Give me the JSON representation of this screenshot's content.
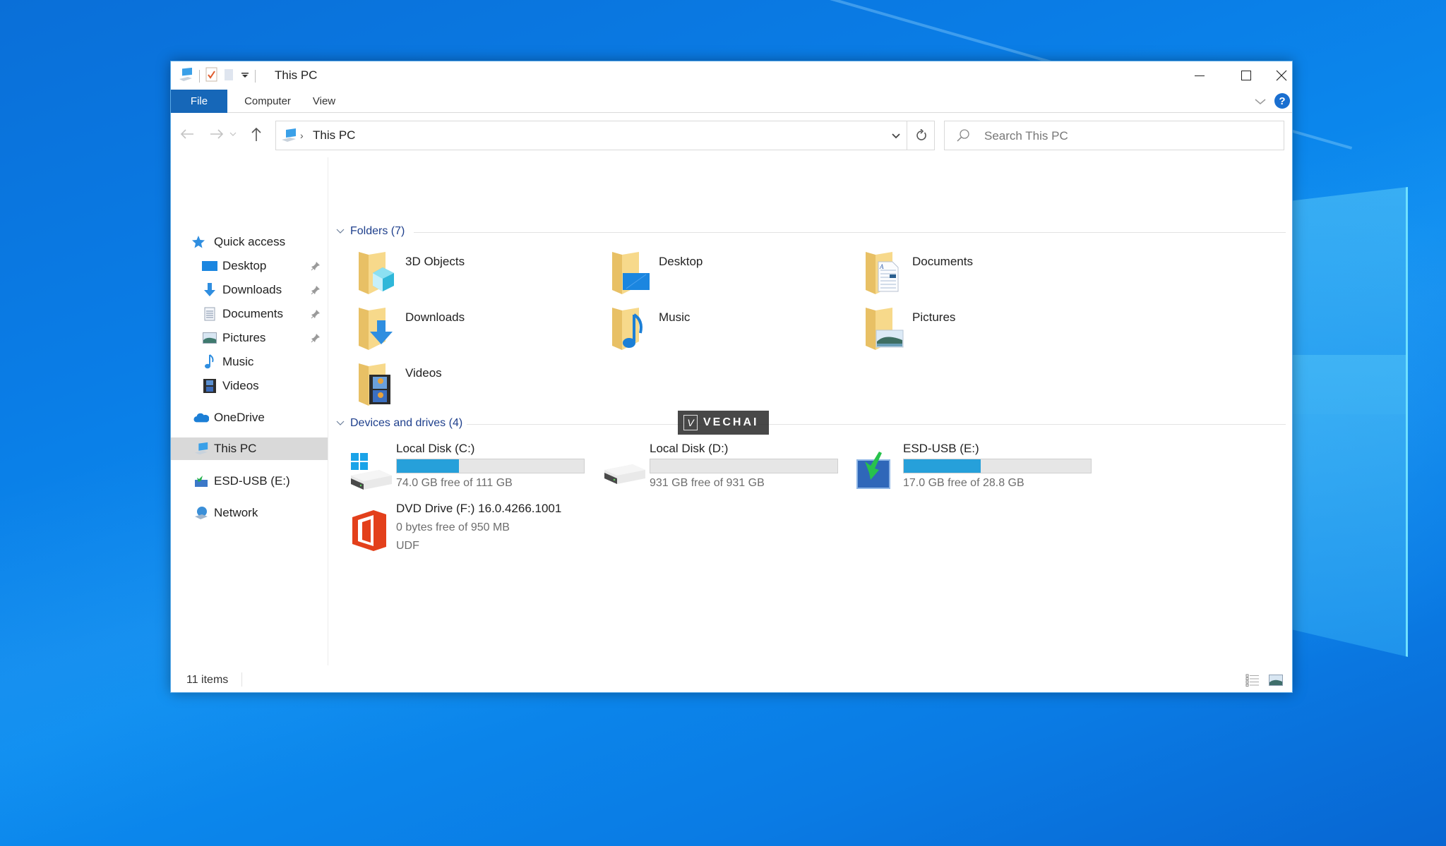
{
  "window": {
    "title": "This PC",
    "controls": {
      "minimize": "minimize",
      "maximize": "maximize",
      "close": "close"
    }
  },
  "quick_access_toolbar": {
    "icons": [
      "this-pc-icon",
      "properties-icon",
      "new-folder-icon",
      "customize-dropdown-icon"
    ]
  },
  "ribbon": {
    "tabs": [
      {
        "label": "File",
        "active": true
      },
      {
        "label": "Computer",
        "active": false
      },
      {
        "label": "View",
        "active": false
      }
    ],
    "help_label": "?"
  },
  "address_bar": {
    "breadcrumb": [
      "This PC"
    ],
    "separator": "›"
  },
  "search": {
    "placeholder": "Search This PC",
    "value": ""
  },
  "nav_pane": {
    "items": [
      {
        "label": "Quick access",
        "icon": "star-icon",
        "pinned": false,
        "indent": 0
      },
      {
        "label": "Desktop",
        "icon": "desktop-icon",
        "pinned": true,
        "indent": 1
      },
      {
        "label": "Downloads",
        "icon": "download-arrow-icon",
        "pinned": true,
        "indent": 1
      },
      {
        "label": "Documents",
        "icon": "document-icon",
        "pinned": true,
        "indent": 1
      },
      {
        "label": "Pictures",
        "icon": "picture-icon",
        "pinned": true,
        "indent": 1
      },
      {
        "label": "Music",
        "icon": "music-note-icon",
        "pinned": false,
        "indent": 1
      },
      {
        "label": "Videos",
        "icon": "film-icon",
        "pinned": false,
        "indent": 1
      },
      {
        "label": "OneDrive",
        "icon": "cloud-icon",
        "pinned": false,
        "indent": 0
      },
      {
        "label": "This PC",
        "icon": "computer-icon",
        "pinned": false,
        "indent": 0,
        "selected": true
      },
      {
        "label": "ESD-USB (E:)",
        "icon": "usb-drive-icon",
        "pinned": false,
        "indent": 0
      },
      {
        "label": "Network",
        "icon": "network-icon",
        "pinned": false,
        "indent": 0
      }
    ]
  },
  "content": {
    "folders_header": "Folders (7)",
    "folders": [
      {
        "name": "3D Objects",
        "overlay": "cube"
      },
      {
        "name": "Desktop",
        "overlay": "desktop"
      },
      {
        "name": "Documents",
        "overlay": "document"
      },
      {
        "name": "Downloads",
        "overlay": "download"
      },
      {
        "name": "Music",
        "overlay": "music"
      },
      {
        "name": "Pictures",
        "overlay": "picture"
      },
      {
        "name": "Videos",
        "overlay": "film"
      }
    ],
    "drives_header": "Devices and drives (4)",
    "drives": [
      {
        "name": "Local Disk (C:)",
        "free_text": "74.0 GB free of 111 GB",
        "used_fraction": 0.333,
        "icon": "windows-drive"
      },
      {
        "name": "Local Disk (D:)",
        "free_text": "931 GB free of 931 GB",
        "used_fraction": 0.0,
        "icon": "hard-drive"
      },
      {
        "name": "ESD-USB (E:)",
        "free_text": "17.0 GB free of 28.8 GB",
        "used_fraction": 0.41,
        "icon": "usb-drive"
      }
    ],
    "dvd": {
      "name": "DVD Drive (F:) 16.0.4266.1001",
      "free_text": "0 bytes free of 950 MB",
      "filesystem": "UDF"
    }
  },
  "watermark": {
    "text": "VECHAI",
    "logo": "V"
  },
  "status_bar": {
    "item_count": "11 items"
  },
  "colors": {
    "accent": "#1667b8",
    "progress": "#26a0da",
    "group_header": "#1e3f8c",
    "selected_nav": "#d9d9d9",
    "office_orange": "#e3401b"
  }
}
